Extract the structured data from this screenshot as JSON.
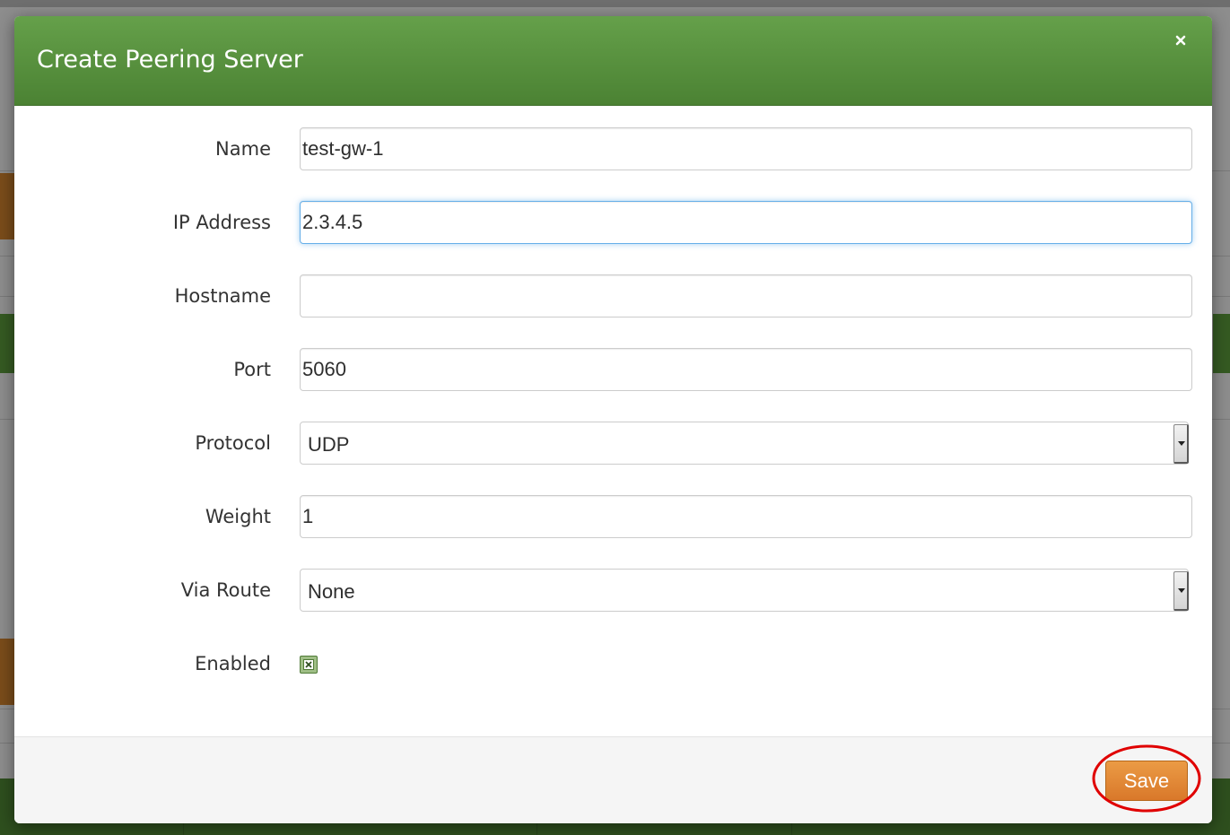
{
  "dialog": {
    "title": "Create Peering Server",
    "close_symbol": "×"
  },
  "form": {
    "name": {
      "label": "Name",
      "value": "test-gw-1"
    },
    "ip_address": {
      "label": "IP Address",
      "value": "2.3.4.5"
    },
    "hostname": {
      "label": "Hostname",
      "value": ""
    },
    "port": {
      "label": "Port",
      "value": "5060"
    },
    "protocol": {
      "label": "Protocol",
      "selected": "UDP"
    },
    "weight": {
      "label": "Weight",
      "value": "1"
    },
    "via_route": {
      "label": "Via Route",
      "selected": "None"
    },
    "enabled": {
      "label": "Enabled",
      "checked": true
    }
  },
  "footer": {
    "save_label": "Save"
  },
  "colors": {
    "header_green": "#5a9541",
    "save_orange": "#e58a35",
    "annotation_red": "#e00000",
    "focus_blue": "#66afe9"
  },
  "icons": {
    "close": "close-icon",
    "select_arrow": "chevron-down-icon",
    "checkbox": "checkbox-checked-icon"
  }
}
